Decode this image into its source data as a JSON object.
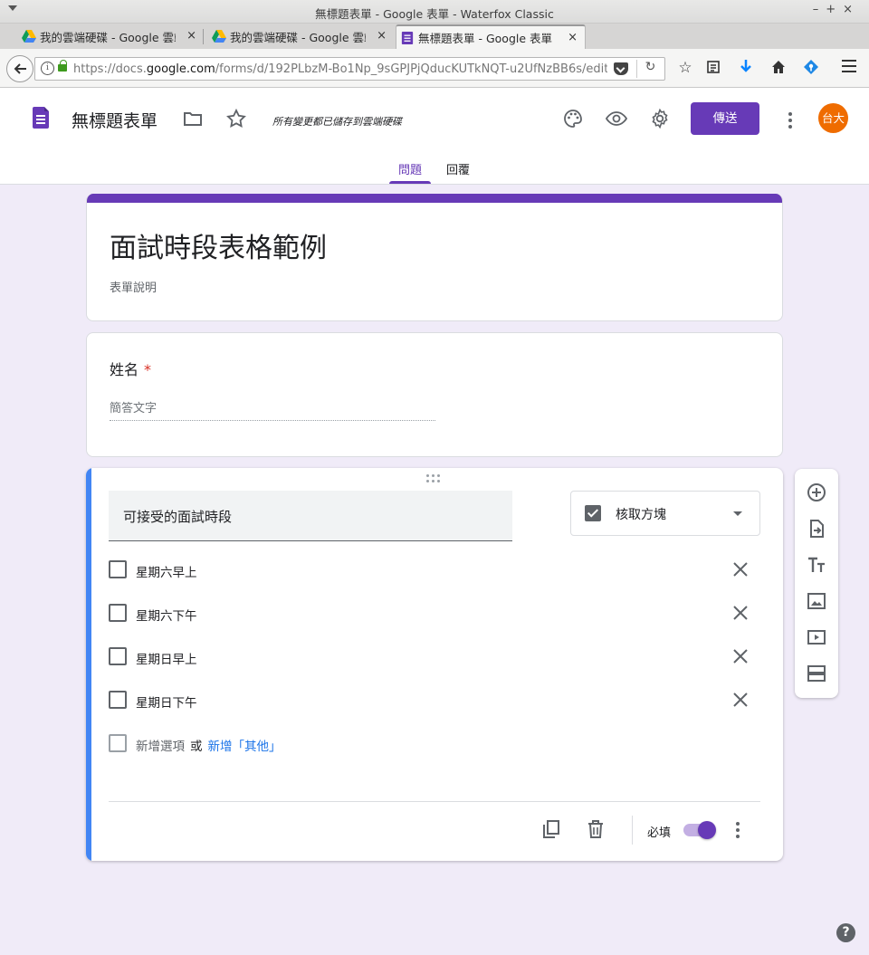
{
  "window": {
    "title": "無標題表單 - Google 表單 - Waterfox Classic"
  },
  "browser": {
    "tabs": [
      {
        "label": "我的雲端硬碟 - Google 雲端",
        "close": "×"
      },
      {
        "label": "我的雲端硬碟 - Google 雲端",
        "close": "×"
      },
      {
        "label": "無標題表單 - Google 表單",
        "close": "×"
      }
    ],
    "new_tab": "+",
    "url_prefix": "https://docs.",
    "url_domain": "google.com",
    "url_path": "/forms/d/192PLbzM-Bo1Np_9sGPJPjQducKUTkNQT-u2UfNzBB6s/edit",
    "reload": "↻"
  },
  "header": {
    "title": "無標題表單",
    "saved_status": "所有變更都已儲存到雲端硬碟",
    "send_label": "傳送",
    "avatar_text": "台大",
    "tabs": {
      "questions": "問題",
      "responses": "回覆"
    }
  },
  "form": {
    "title": "面試時段表格範例",
    "description": "表單說明",
    "questions": [
      {
        "label": "姓名",
        "required_mark": "*",
        "placeholder": "簡答文字"
      },
      {
        "title": "可接受的面試時段",
        "type_label": "核取方塊",
        "options": [
          "星期六早上",
          "星期六下午",
          "星期日早上",
          "星期日下午"
        ],
        "add_option": "新增選項",
        "or_text": "或",
        "add_other": "新增「其他」",
        "required_label": "必填",
        "required": true
      }
    ]
  },
  "colors": {
    "accent": "#673ab7",
    "background": "#f0ebf8",
    "active_question_bar": "#4285f4",
    "avatar": "#ef6c00"
  },
  "help": "?"
}
